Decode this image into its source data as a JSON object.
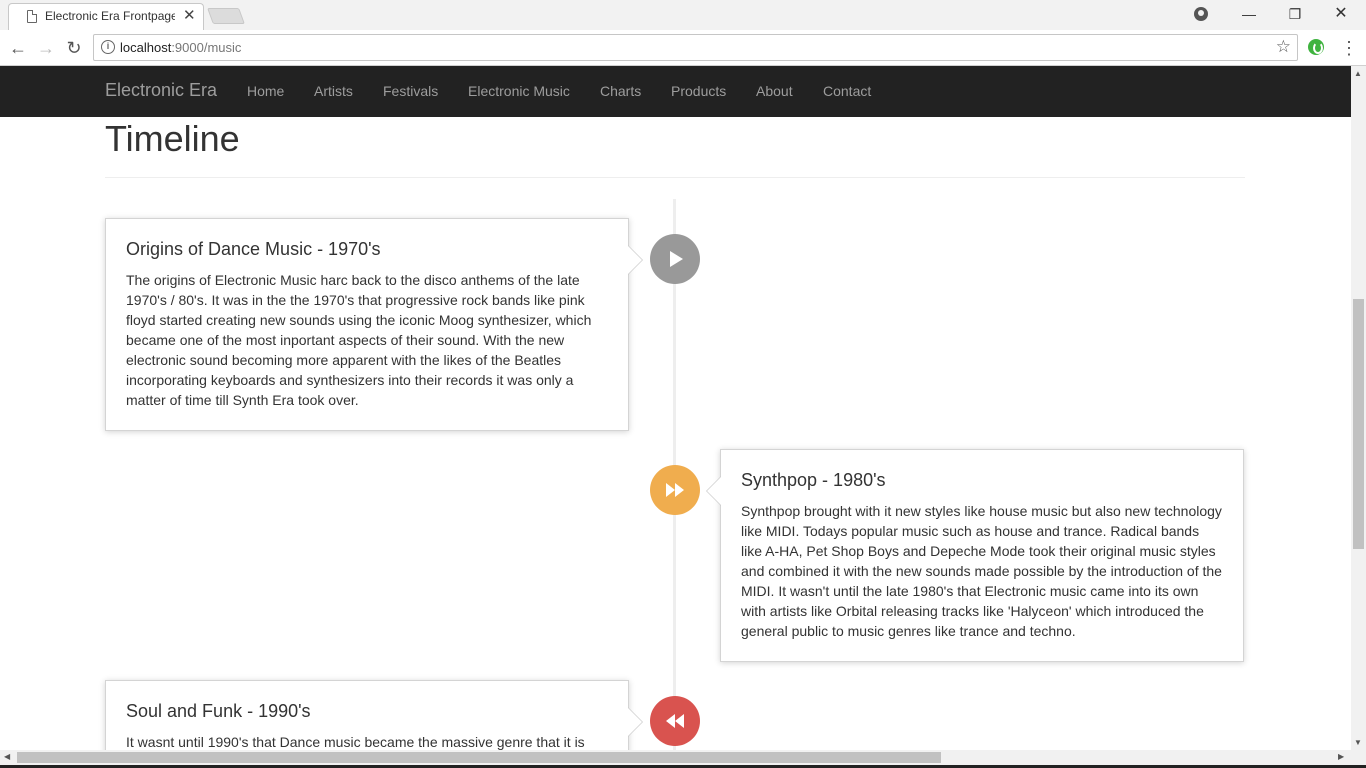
{
  "browser": {
    "tab_title": "Electronic Era Frontpage",
    "tab_close": "✕",
    "url_host": "localhost",
    "url_path": ":9000/music",
    "back": "←",
    "forward": "→",
    "reload": "↻",
    "star": "☆",
    "menu": "⋮",
    "minimize": "—",
    "restore": "❐",
    "close": "✕"
  },
  "navbar": {
    "brand": "Electronic Era",
    "links": [
      "Home",
      "Artists",
      "Festivals",
      "Electronic Music",
      "Charts",
      "Products",
      "About",
      "Contact"
    ]
  },
  "page": {
    "title": "Timeline"
  },
  "timeline": [
    {
      "heading": "Origins of Dance Music - 1970's",
      "body": "The origins of Electronic Music harc back to the disco anthems of the late 1970's / 80's. It was in the the 1970's that progressive rock bands like pink floyd started creating new sounds using the iconic Moog synthesizer, which became one of the most inportant aspects of their sound. With the new electronic sound becoming more apparent with the likes of the Beatles incorporating keyboards and synthesizers into their records it was only a matter of time till Synth Era took over.",
      "side": "left",
      "badge_icon": "play-icon",
      "badge_color": "#999999"
    },
    {
      "heading": "Synthpop - 1980's",
      "body": "Synthpop brought with it new styles like house music but also new technology like MIDI. Todays popular music such as house and trance. Radical bands like A-HA, Pet Shop Boys and Depeche Mode took their original music styles and combined it with the new sounds made possible by the introduction of the MIDI. It wasn't until the late 1980's that Electronic music came into its own with artists like Orbital releasing tracks like 'Halyceon' which introduced the general public to music genres like trance and techno.",
      "side": "right",
      "badge_icon": "fast-forward-icon",
      "badge_color": "#f0ad4e"
    },
    {
      "heading": "Soul and Funk - 1990's",
      "body": "It wasnt until 1990's that Dance music became the massive genre that it is",
      "side": "left",
      "badge_icon": "rewind-icon",
      "badge_color": "#d9534f"
    }
  ]
}
